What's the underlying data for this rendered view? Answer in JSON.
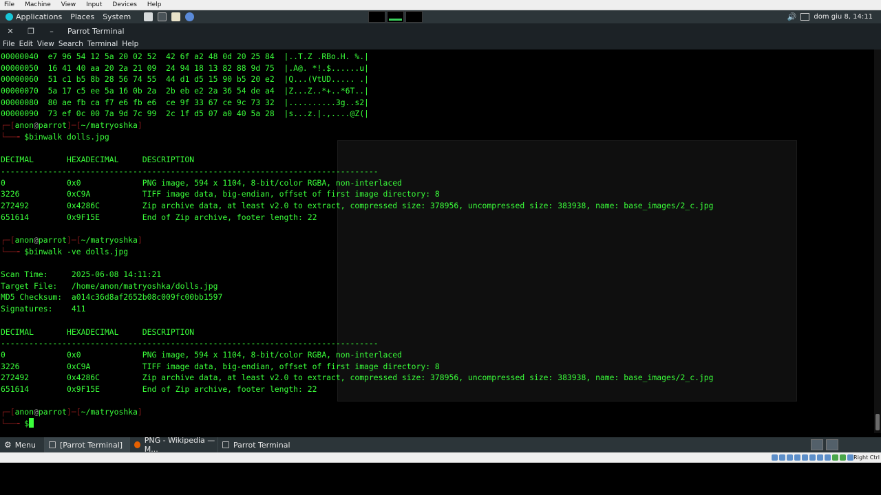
{
  "vbox_menu": [
    "File",
    "Machine",
    "View",
    "Input",
    "Devices",
    "Help"
  ],
  "top_panel": {
    "menus": [
      "Applications",
      "Places",
      "System"
    ],
    "clock": "dom giu  8, 14:11"
  },
  "window": {
    "title": "Parrot Terminal",
    "menu": [
      "File",
      "Edit",
      "View",
      "Search",
      "Terminal",
      "Help"
    ]
  },
  "terminal_lines": [
    {
      "type": "out",
      "text": "00000040  e7 96 54 12 5a 20 02 52  42 6f a2 48 0d 20 25 84  |..T.Z .RBo.H. %.|"
    },
    {
      "type": "out",
      "text": "00000050  16 41 40 aa 20 2a 21 09  24 94 18 13 82 88 9d 75  |.A@. *!.$......u|"
    },
    {
      "type": "out",
      "text": "00000060  51 c1 b5 8b 28 56 74 55  44 d1 d5 15 90 b5 20 e2  |Q...(VtUD..... .|"
    },
    {
      "type": "out",
      "text": "00000070  5a 17 c5 ee 5a 16 0b 2a  2b eb e2 2a 36 54 de a4  |Z...Z..*+..*6T..|"
    },
    {
      "type": "out",
      "text": "00000080  80 ae fb ca f7 e6 fb e6  ce 9f 33 67 ce 9c 73 32  |..........3g..s2|"
    },
    {
      "type": "out",
      "text": "00000090  73 ef 0c 00 7a 9d 7c 99  2c 1f d5 07 a0 40 5a 28  |s...z.|.,....@Z(|"
    },
    {
      "type": "prompt1",
      "user": "anon",
      "at": "@",
      "host": "parrot",
      "dir": "~/matryoshka"
    },
    {
      "type": "prompt2",
      "cmd": "binwalk dolls.jpg"
    },
    {
      "type": "out",
      "text": ""
    },
    {
      "type": "out",
      "text": "DECIMAL       HEXADECIMAL     DESCRIPTION"
    },
    {
      "type": "out",
      "text": "--------------------------------------------------------------------------------"
    },
    {
      "type": "out",
      "text": "0             0x0             PNG image, 594 x 1104, 8-bit/color RGBA, non-interlaced"
    },
    {
      "type": "out",
      "text": "3226          0xC9A           TIFF image data, big-endian, offset of first image directory: 8"
    },
    {
      "type": "out",
      "text": "272492        0x4286C         Zip archive data, at least v2.0 to extract, compressed size: 378956, uncompressed size: 383938, name: base_images/2_c.jpg"
    },
    {
      "type": "out",
      "text": "651614        0x9F15E         End of Zip archive, footer length: 22"
    },
    {
      "type": "out",
      "text": ""
    },
    {
      "type": "prompt1",
      "user": "anon",
      "at": "@",
      "host": "parrot",
      "dir": "~/matryoshka"
    },
    {
      "type": "prompt2",
      "cmd": "binwalk -ve dolls.jpg"
    },
    {
      "type": "out",
      "text": ""
    },
    {
      "type": "out",
      "text": "Scan Time:     2025-06-08 14:11:21"
    },
    {
      "type": "out",
      "text": "Target File:   /home/anon/matryoshka/dolls.jpg"
    },
    {
      "type": "out",
      "text": "MD5 Checksum:  a014c36d8af2652b08c009fc00bb1597"
    },
    {
      "type": "out",
      "text": "Signatures:    411"
    },
    {
      "type": "out",
      "text": ""
    },
    {
      "type": "out",
      "text": "DECIMAL       HEXADECIMAL     DESCRIPTION"
    },
    {
      "type": "out",
      "text": "--------------------------------------------------------------------------------"
    },
    {
      "type": "out",
      "text": "0             0x0             PNG image, 594 x 1104, 8-bit/color RGBA, non-interlaced"
    },
    {
      "type": "out",
      "text": "3226          0xC9A           TIFF image data, big-endian, offset of first image directory: 8"
    },
    {
      "type": "out",
      "text": "272492        0x4286C         Zip archive data, at least v2.0 to extract, compressed size: 378956, uncompressed size: 383938, name: base_images/2_c.jpg"
    },
    {
      "type": "out",
      "text": "651614        0x9F15E         End of Zip archive, footer length: 22"
    },
    {
      "type": "out",
      "text": ""
    },
    {
      "type": "prompt1",
      "user": "anon",
      "at": "@",
      "host": "parrot",
      "dir": "~/matryoshka"
    },
    {
      "type": "prompt2",
      "cmd": "",
      "cursor": true
    }
  ],
  "taskbar": {
    "menu_label": "Menu",
    "tasks": [
      {
        "label": "[Parrot Terminal]",
        "active": true
      },
      {
        "label": "PNG - Wikipedia — M...",
        "active": false
      },
      {
        "label": "Parrot Terminal",
        "active": false
      }
    ]
  },
  "vbox_status": {
    "host_key": "Right Ctrl"
  },
  "colors": {
    "terminal_text": "#3aff3a",
    "prompt_bracket": "#8a1b1b",
    "panel": "#2c3539"
  }
}
